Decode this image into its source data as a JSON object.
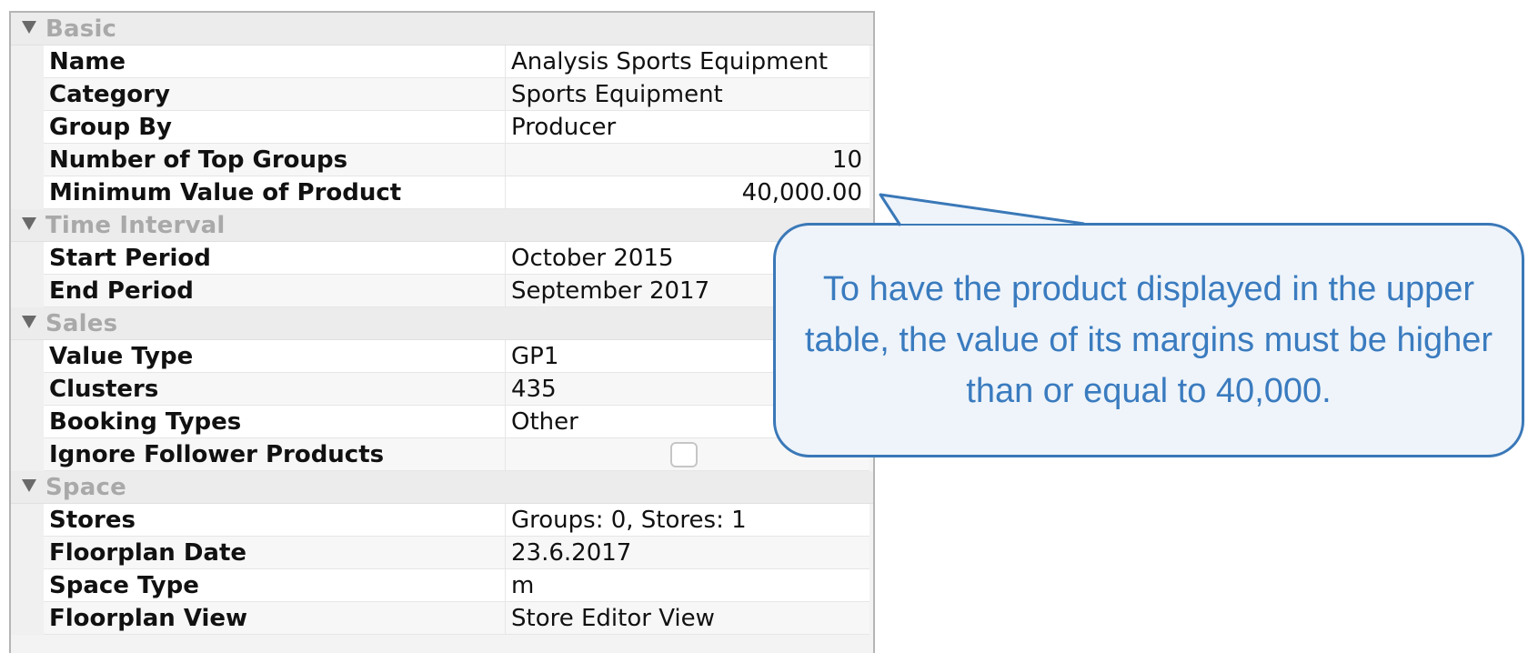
{
  "sections": [
    {
      "title": "Basic",
      "rows": [
        {
          "label": "Name",
          "value": "Analysis Sports Equipment"
        },
        {
          "label": "Category",
          "value": "Sports Equipment"
        },
        {
          "label": "Group By",
          "value": "Producer"
        },
        {
          "label": "Number of Top Groups",
          "value": "10"
        },
        {
          "label": "Minimum Value of Product",
          "value": "40,000.00"
        }
      ]
    },
    {
      "title": "Time Interval",
      "rows": [
        {
          "label": "Start Period",
          "value": "October 2015"
        },
        {
          "label": "End Period",
          "value": "September 2017"
        }
      ]
    },
    {
      "title": "Sales",
      "rows": [
        {
          "label": "Value Type",
          "value": "GP1"
        },
        {
          "label": "Clusters",
          "value": "435"
        },
        {
          "label": "Booking Types",
          "value": "Other"
        },
        {
          "label": "Ignore Follower Products",
          "value": false
        }
      ]
    },
    {
      "title": "Space",
      "rows": [
        {
          "label": "Stores",
          "value": "Groups: 0, Stores: 1"
        },
        {
          "label": "Floorplan Date",
          "value": "23.6.2017"
        },
        {
          "label": "Space Type",
          "value": "m"
        },
        {
          "label": "Floorplan View",
          "value": "Store Editor View"
        }
      ]
    }
  ],
  "callout": {
    "text": "To have the product displayed in the upper table, the value of its margins must be higher than or equal to 40,000."
  },
  "colors": {
    "callout_border": "#3a78b8",
    "callout_fill": "#eef4fa",
    "callout_text": "#3a7bbf",
    "section_title": "#a9a9a9"
  },
  "icons": {
    "section_toggle": "triangle-down-icon"
  }
}
